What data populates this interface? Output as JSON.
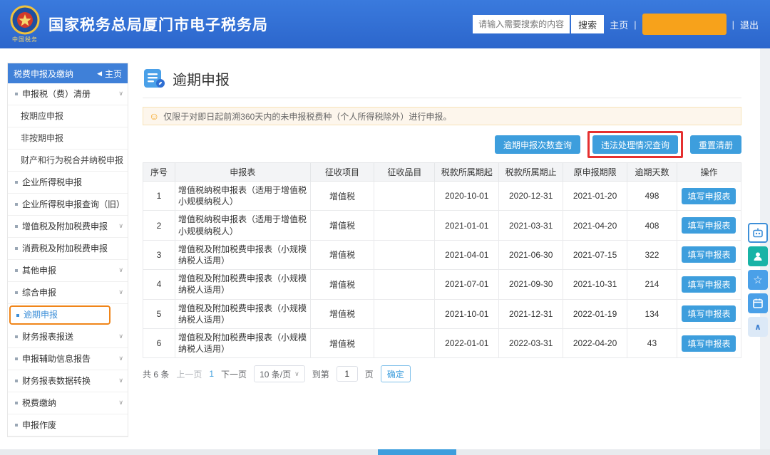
{
  "header": {
    "title": "国家税务总局厦门市电子税务局",
    "logo_caption": "中国税务",
    "search": {
      "placeholder": "请输入需要搜索的内容",
      "button": "搜索"
    },
    "home": "主页",
    "sep": "|",
    "logout": "退出"
  },
  "sidebar": {
    "title": "税费申报及缴纳",
    "home_link": "主页",
    "items": [
      {
        "label": "申报税（费）清册"
      },
      {
        "label": "按期应申报"
      },
      {
        "label": "非按期申报"
      },
      {
        "label": "财产和行为税合并纳税申报"
      },
      {
        "label": "企业所得税申报"
      },
      {
        "label": "企业所得税申报查询（旧）"
      },
      {
        "label": "增值税及附加税费申报"
      },
      {
        "label": "消费税及附加税费申报"
      },
      {
        "label": "其他申报"
      },
      {
        "label": "综合申报"
      },
      {
        "label": "逾期申报"
      },
      {
        "label": "财务报表报送"
      },
      {
        "label": "申报辅助信息报告"
      },
      {
        "label": "财务报表数据转换"
      },
      {
        "label": "税费缴纳"
      },
      {
        "label": "申报作废"
      }
    ]
  },
  "main": {
    "page_title": "逾期申报",
    "notice": "仅限于对即日起前溯360天内的未申报税费种（个人所得税除外）进行申报。",
    "action_buttons": {
      "overdue_count_query": "逾期申报次数查询",
      "violation_query": "违法处理情况查询",
      "reset": "重置清册"
    },
    "table": {
      "columns": [
        "序号",
        "申报表",
        "征收项目",
        "征收品目",
        "税款所属期起",
        "税款所属期止",
        "原申报期限",
        "逾期天数",
        "操作"
      ],
      "action_label": "填写申报表",
      "rows": [
        {
          "no": "1",
          "form": "增值税纳税申报表（适用于增值税小规模纳税人）",
          "project": "增值税",
          "item": "",
          "start": "2020-10-01",
          "end": "2020-12-31",
          "deadline": "2021-01-20",
          "days": "498"
        },
        {
          "no": "2",
          "form": "增值税纳税申报表（适用于增值税小规模纳税人）",
          "project": "增值税",
          "item": "",
          "start": "2021-01-01",
          "end": "2021-03-31",
          "deadline": "2021-04-20",
          "days": "408"
        },
        {
          "no": "3",
          "form": "增值税及附加税费申报表（小规模纳税人适用）",
          "project": "增值税",
          "item": "",
          "start": "2021-04-01",
          "end": "2021-06-30",
          "deadline": "2021-07-15",
          "days": "322"
        },
        {
          "no": "4",
          "form": "增值税及附加税费申报表（小规模纳税人适用）",
          "project": "增值税",
          "item": "",
          "start": "2021-07-01",
          "end": "2021-09-30",
          "deadline": "2021-10-31",
          "days": "214"
        },
        {
          "no": "5",
          "form": "增值税及附加税费申报表（小规模纳税人适用）",
          "project": "增值税",
          "item": "",
          "start": "2021-10-01",
          "end": "2021-12-31",
          "deadline": "2022-01-19",
          "days": "134"
        },
        {
          "no": "6",
          "form": "增值税及附加税费申报表（小规模纳税人适用）",
          "project": "增值税",
          "item": "",
          "start": "2022-01-01",
          "end": "2022-03-31",
          "deadline": "2022-04-20",
          "days": "43"
        }
      ]
    },
    "pagination": {
      "total": "共 6 条",
      "prev": "上一页",
      "page": "1",
      "next": "下一页",
      "page_size": "10 条/页",
      "goto_prefix": "到第",
      "goto_value": "1",
      "goto_suffix": "页",
      "confirm": "确定"
    }
  },
  "icons": {
    "chevron_down": "∨",
    "home_arrow": "◀",
    "notice_smiley": "☺",
    "star": "☆",
    "collapse": "∧"
  },
  "colors": {
    "header_blue": "#2e6ed0",
    "sidebar_header_blue": "#3f80d8",
    "button_blue": "#3d9edd",
    "annotation_red": "#e53030",
    "annotation_orange": "#f08519",
    "notice_bg": "#fdf6ec",
    "redaction_orange": "#f7a21b",
    "active_text_blue": "#3d8fd8"
  }
}
